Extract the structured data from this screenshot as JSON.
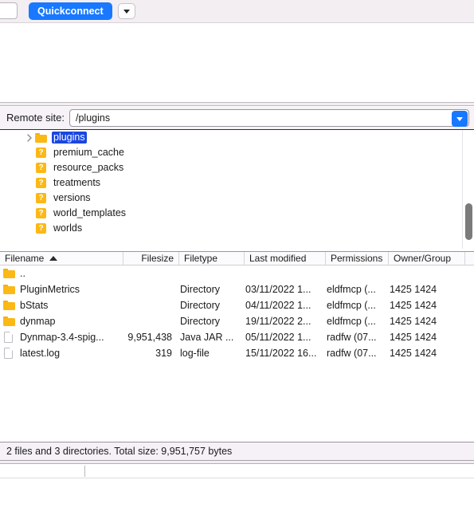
{
  "toolbar": {
    "quickconnect_label": "Quickconnect",
    "quickconnect_dropdown_icon": "chevron-down-icon",
    "host_field_value": ""
  },
  "remote_site": {
    "label": "Remote site:",
    "path_value": "/plugins",
    "dropdown_icon": "chevron-down-icon"
  },
  "tree": {
    "items": [
      {
        "label": "plugins",
        "icon": "folder-icon",
        "selected": true,
        "has_disclosure": true,
        "indent": 0
      },
      {
        "label": "premium_cache",
        "icon": "unknown-icon",
        "selected": false,
        "has_disclosure": false,
        "indent": 0
      },
      {
        "label": "resource_packs",
        "icon": "unknown-icon",
        "selected": false,
        "has_disclosure": false,
        "indent": 0
      },
      {
        "label": "treatments",
        "icon": "unknown-icon",
        "selected": false,
        "has_disclosure": false,
        "indent": 0
      },
      {
        "label": "versions",
        "icon": "unknown-icon",
        "selected": false,
        "has_disclosure": false,
        "indent": 0
      },
      {
        "label": "world_templates",
        "icon": "unknown-icon",
        "selected": false,
        "has_disclosure": false,
        "indent": 0
      },
      {
        "label": "worlds",
        "icon": "unknown-icon",
        "selected": false,
        "has_disclosure": false,
        "indent": 0
      }
    ]
  },
  "filelist": {
    "columns": [
      {
        "key": "filename",
        "label": "Filename",
        "sorted": "asc"
      },
      {
        "key": "filesize",
        "label": "Filesize",
        "sorted": ""
      },
      {
        "key": "filetype",
        "label": "Filetype",
        "sorted": ""
      },
      {
        "key": "lastmod",
        "label": "Last modified",
        "sorted": ""
      },
      {
        "key": "permissions",
        "label": "Permissions",
        "sorted": ""
      },
      {
        "key": "ownergroup",
        "label": "Owner/Group",
        "sorted": ""
      }
    ],
    "rows": [
      {
        "icon": "folder-icon",
        "filename": "..",
        "filesize": "",
        "filetype": "",
        "lastmod": "",
        "permissions": "",
        "ownergroup": ""
      },
      {
        "icon": "folder-icon",
        "filename": "PluginMetrics",
        "filesize": "",
        "filetype": "Directory",
        "lastmod": "03/11/2022 1...",
        "permissions": "eldfmcp (...",
        "ownergroup": "1425 1424"
      },
      {
        "icon": "folder-icon",
        "filename": "bStats",
        "filesize": "",
        "filetype": "Directory",
        "lastmod": "04/11/2022 1...",
        "permissions": "eldfmcp (...",
        "ownergroup": "1425 1424"
      },
      {
        "icon": "folder-icon",
        "filename": "dynmap",
        "filesize": "",
        "filetype": "Directory",
        "lastmod": "19/11/2022 2...",
        "permissions": "eldfmcp (...",
        "ownergroup": "1425 1424"
      },
      {
        "icon": "file-icon",
        "filename": "Dynmap-3.4-spig...",
        "filesize": "9,951,438",
        "filetype": "Java JAR ...",
        "lastmod": "05/11/2022 1...",
        "permissions": "radfw (07...",
        "ownergroup": "1425 1424"
      },
      {
        "icon": "file-icon",
        "filename": "latest.log",
        "filesize": "319",
        "filetype": "log-file",
        "lastmod": "15/11/2022 16...",
        "permissions": "radfw (07...",
        "ownergroup": "1425 1424"
      }
    ]
  },
  "status": {
    "text": "2 files and 3 directories. Total size: 9,951,757 bytes"
  },
  "colors": {
    "accent_blue": "#1878ff",
    "selection_blue": "#1a47e0",
    "folder_yellow": "#fcb814",
    "chrome_lavender": "#f2eef2"
  }
}
